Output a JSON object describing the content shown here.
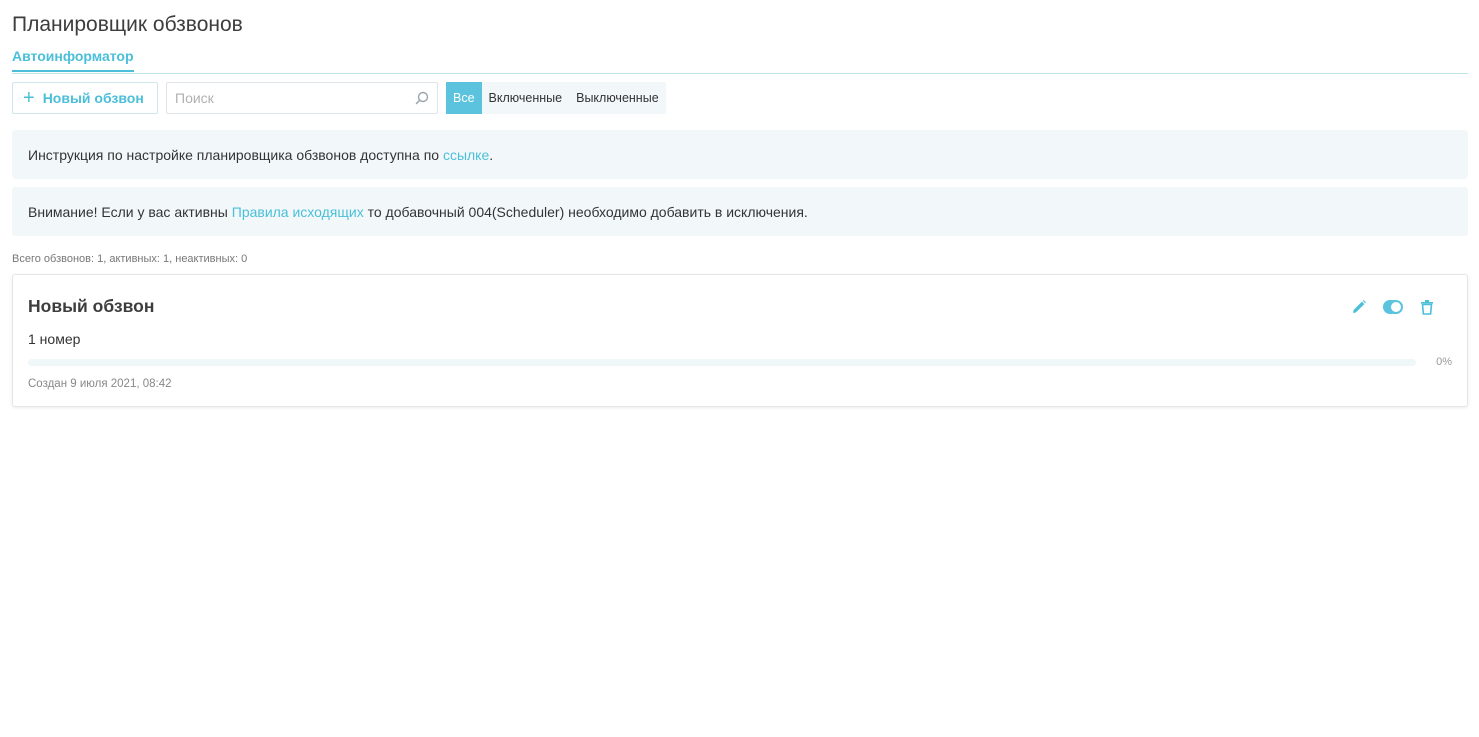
{
  "page": {
    "title": "Планировщик обзвонов"
  },
  "tabs": [
    {
      "label": "Автоинформатор",
      "active": true
    }
  ],
  "toolbar": {
    "new_button_icon": "plus-icon",
    "new_button_label": "Новый обзвон",
    "search_placeholder": "Поиск",
    "search_value": "",
    "filters": [
      {
        "label": "Все",
        "active": true
      },
      {
        "label": "Включенные",
        "active": false
      },
      {
        "label": "Выключенные",
        "active": false
      }
    ]
  },
  "alerts": {
    "instruction": {
      "text_before": "Инструкция по настройке планировщика обзвонов доступна по ",
      "link": "ссылке",
      "text_after": "."
    },
    "warning": {
      "text_before": "Внимание! Если у вас активны ",
      "link": "Правила исходящих",
      "text_after": " то добавочный 004(Scheduler) необходимо добавить в исключения."
    }
  },
  "summary": "Всего обзвонов: 1, активных: 1, неактивных: 0",
  "campaigns": [
    {
      "title": "Новый обзвон",
      "count": "1 номер",
      "progress": 0,
      "progress_label": "0%",
      "created": "Создан 9 июля 2021, 08:42",
      "enabled": true
    }
  ],
  "colors": {
    "accent": "#4bbfd9",
    "panel": "#f2f8fa"
  }
}
